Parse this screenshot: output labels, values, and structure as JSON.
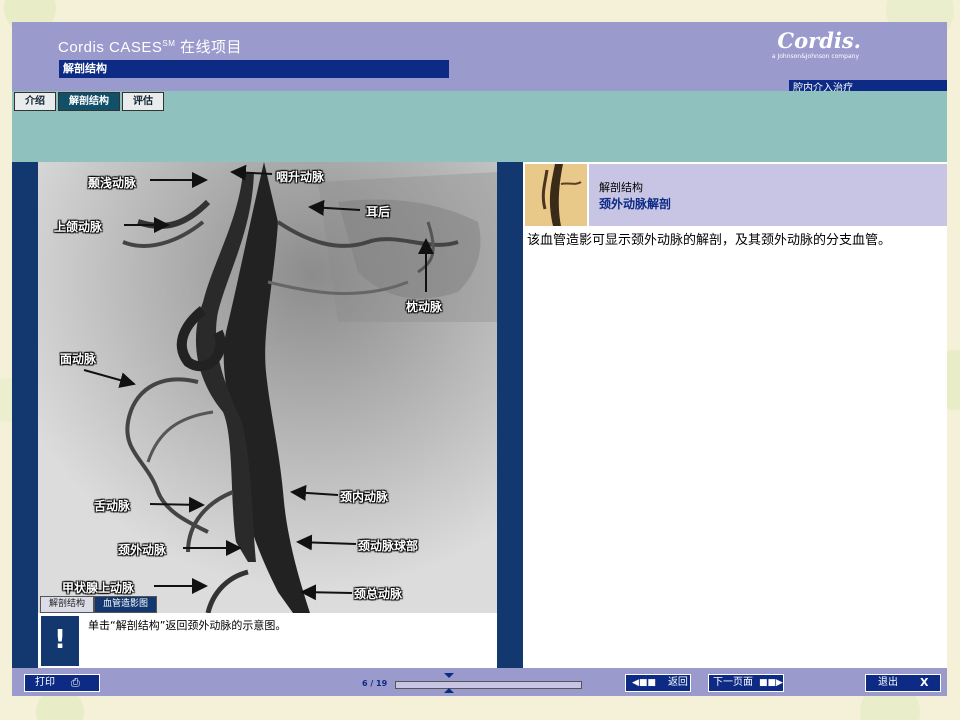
{
  "header": {
    "title": "Cordis CASES",
    "title_sup": "SM",
    "title_suffix": " 在线项目",
    "section": "解剖结构",
    "logo": "Cordis.",
    "logo_sub": "a Johnson&Johnson company",
    "category": "腔内介入治疗"
  },
  "tabs": [
    {
      "label": "介绍",
      "active": false
    },
    {
      "label": "解剖结构",
      "active": true
    },
    {
      "label": "评估",
      "active": false
    }
  ],
  "angiogram": {
    "labels": {
      "superficial_temporal": "颞浅动脉",
      "pharyngeal": "咽升动脉",
      "maxillary": "上颌动脉",
      "posterior_auricular": "耳后",
      "occipital": "枕动脉",
      "facial": "面动脉",
      "lingual": "舌动脉",
      "internal_carotid": "颈内动脉",
      "external_carotid": "颈外动脉",
      "carotid_bulb": "颈动脉球部",
      "superior_thyroid": "甲状腺上动脉",
      "common_carotid": "颈总动脉"
    },
    "subtabs": [
      "解剖结构",
      "血管造影图"
    ]
  },
  "note": {
    "icon": "!",
    "text": "单击“解剖结构”返回颈外动脉的示意图。"
  },
  "info": {
    "small": "解剖结构",
    "title": "颈外动脉解剖",
    "description": "该血管造影可显示颈外动脉的解剖，及其颈外动脉的分支血管。"
  },
  "footer": {
    "print": "打印",
    "page_counter": "6 / 19",
    "back": "返回",
    "next": "下一页面",
    "exit": "退出",
    "exit_x": "X"
  }
}
